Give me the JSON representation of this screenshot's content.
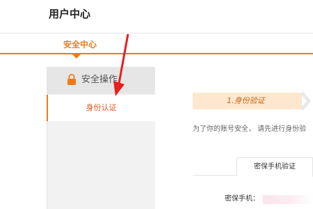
{
  "page": {
    "title": "用户中心"
  },
  "nav": {
    "active_tab": "安全中心"
  },
  "sidebar": {
    "header_label": "安全操作",
    "items": [
      {
        "label": "身份认证",
        "active": true
      }
    ]
  },
  "main": {
    "step_label": "1.身份验证",
    "info_text": "为了你的账号安全， 请先进行身份验",
    "subtab": "密保手机验证",
    "phone_label": "密保手机："
  },
  "colors": {
    "accent": "#f07b16",
    "step_bg": "#fde8cf",
    "sidebar_bg": "#f2f2f2",
    "sidebar_header_bg": "#e6e6e6",
    "annotation_arrow": "#e5201e"
  },
  "icons": {
    "lock": "lock-icon",
    "step_chevron": "chevron-right-icon",
    "annotation": "annotation-arrow"
  }
}
